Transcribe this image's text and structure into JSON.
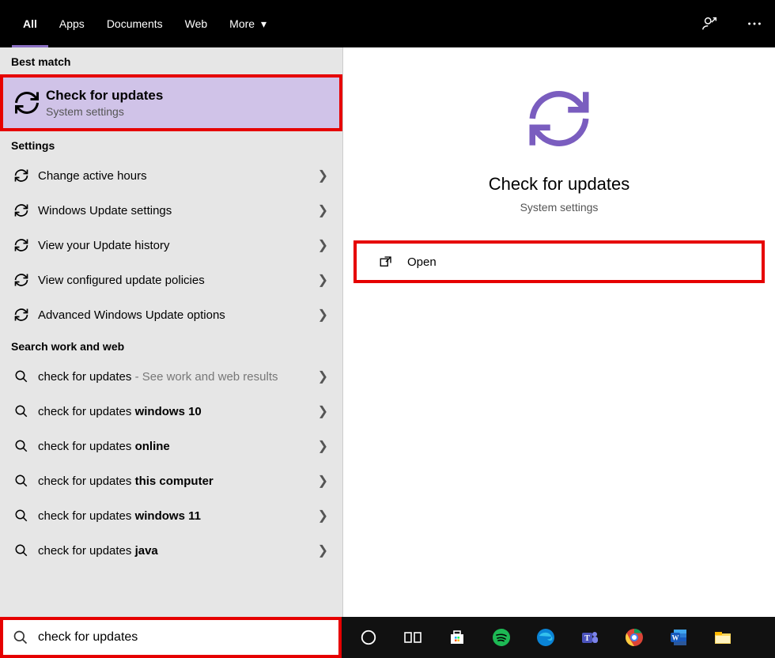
{
  "topbar": {
    "tabs": {
      "all": "All",
      "apps": "Apps",
      "documents": "Documents",
      "web": "Web",
      "more": "More"
    }
  },
  "sections": {
    "best_match": "Best match",
    "settings": "Settings",
    "search_work_web": "Search work and web"
  },
  "best_match": {
    "title": "Check for updates",
    "subtitle": "System settings"
  },
  "settings_items": {
    "0": "Change active hours",
    "1": "Windows Update settings",
    "2": "View your Update history",
    "3": "View configured update policies",
    "4": "Advanced Windows Update options"
  },
  "web_items": {
    "0": {
      "prefix": "check for updates",
      "suffix": "",
      "muted": " - See work and web results"
    },
    "1": {
      "prefix": "check for updates ",
      "suffix": "windows 10"
    },
    "2": {
      "prefix": "check for updates ",
      "suffix": "online"
    },
    "3": {
      "prefix": "check for updates ",
      "suffix": "this computer"
    },
    "4": {
      "prefix": "check for updates ",
      "suffix": "windows 11"
    },
    "5": {
      "prefix": "check for updates ",
      "suffix": "java"
    }
  },
  "right": {
    "title": "Check for updates",
    "subtitle": "System settings",
    "open": "Open"
  },
  "search": {
    "text": "check for updates"
  }
}
